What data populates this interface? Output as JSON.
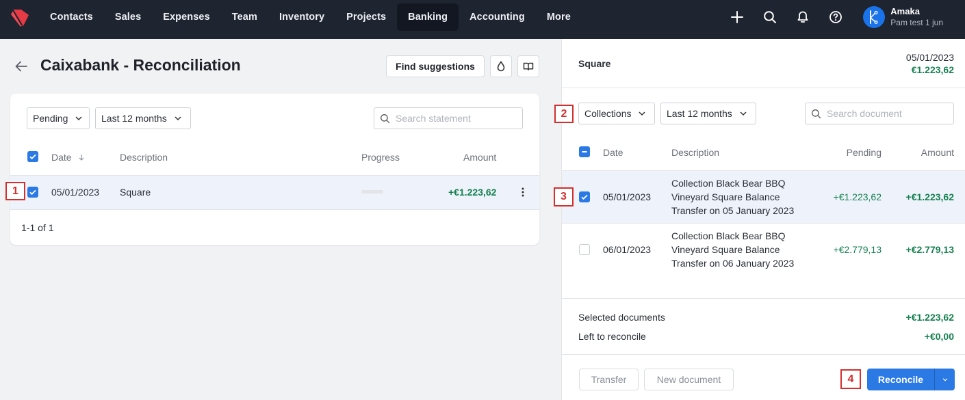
{
  "nav": {
    "items": [
      {
        "label": "Contacts",
        "active": false
      },
      {
        "label": "Sales",
        "active": false
      },
      {
        "label": "Expenses",
        "active": false
      },
      {
        "label": "Team",
        "active": false
      },
      {
        "label": "Inventory",
        "active": false
      },
      {
        "label": "Projects",
        "active": false
      },
      {
        "label": "Banking",
        "active": true
      },
      {
        "label": "Accounting",
        "active": false
      },
      {
        "label": "More",
        "active": false
      }
    ],
    "icons": [
      "plus-icon",
      "search-icon",
      "bell-icon",
      "help-icon"
    ],
    "user": {
      "name": "Amaka",
      "company": "Pam test 1 jun"
    }
  },
  "page": {
    "title": "Caixabank - Reconciliation",
    "find_suggestions_label": "Find suggestions"
  },
  "statement": {
    "filters": {
      "status": "Pending",
      "period": "Last 12 months"
    },
    "search_placeholder": "Search statement",
    "columns": {
      "date": "Date",
      "description": "Description",
      "progress": "Progress",
      "amount": "Amount"
    },
    "rows": [
      {
        "date": "05/01/2023",
        "description": "Square",
        "progress": 0,
        "amount": "+€1.223,62",
        "checked": true
      }
    ],
    "pagination": "1-1 of 1"
  },
  "detail": {
    "name": "Square",
    "date": "05/01/2023",
    "amount": "€1.223,62",
    "filters": {
      "type": "Collections",
      "period": "Last 12 months"
    },
    "search_placeholder": "Search document",
    "columns": {
      "date": "Date",
      "description": "Description",
      "pending": "Pending",
      "amount": "Amount"
    },
    "rows": [
      {
        "date": "05/01/2023",
        "description": "Collection Black Bear BBQ Vineyard Square Balance Transfer on 05 January 2023",
        "pending": "+€1.223,62",
        "amount": "+€1.223,62",
        "checked": true
      },
      {
        "date": "06/01/2023",
        "description": "Collection Black Bear BBQ Vineyard Square Balance Transfer on 06 January 2023",
        "pending": "+€2.779,13",
        "amount": "+€2.779,13",
        "checked": false
      }
    ],
    "summary": {
      "selected_label": "Selected documents",
      "selected_value": "+€1.223,62",
      "left_label": "Left to reconcile",
      "left_value": "+€0,00"
    },
    "buttons": {
      "transfer": "Transfer",
      "new_document": "New document",
      "reconcile": "Reconcile"
    }
  },
  "markers": [
    "1",
    "2",
    "3",
    "4"
  ],
  "colors": {
    "accent": "#2a79e4",
    "positive": "#15804f",
    "nav_bg": "#1e2430",
    "marker": "#d32f2f"
  }
}
